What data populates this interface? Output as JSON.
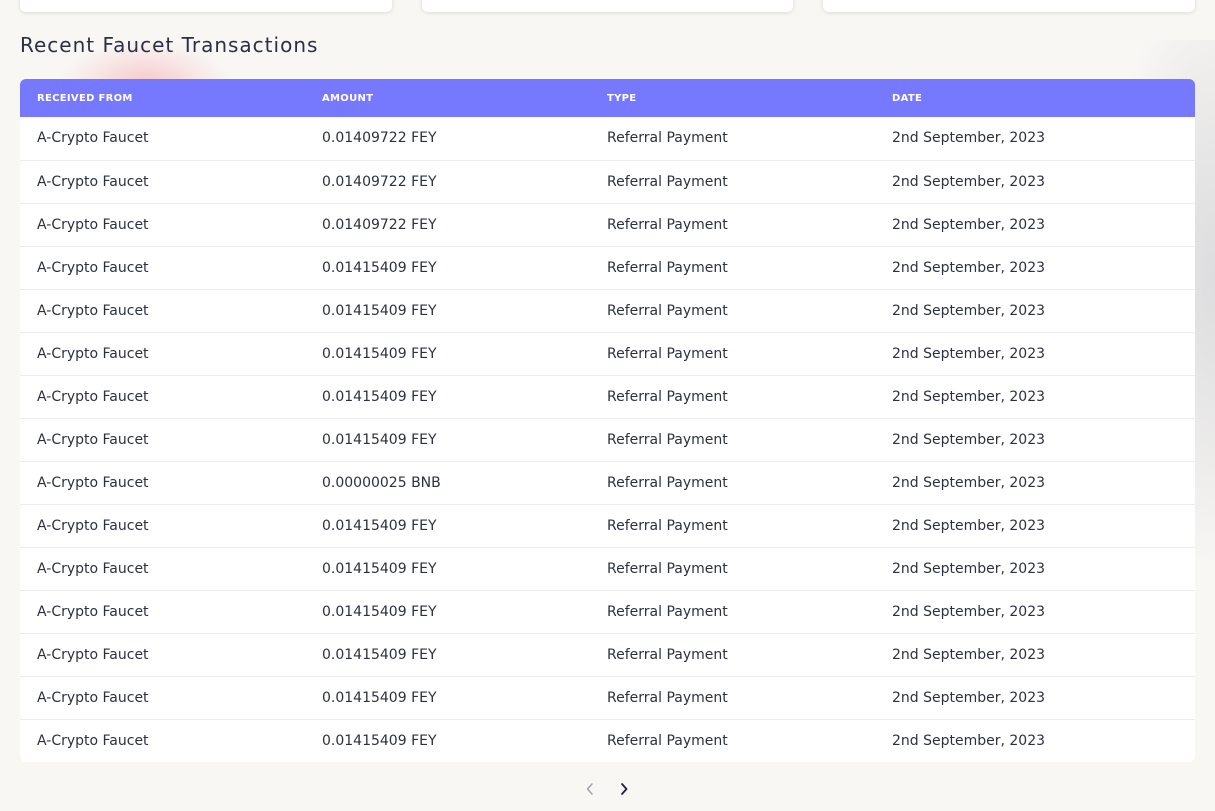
{
  "section": {
    "title": "Recent Faucet Transactions"
  },
  "table": {
    "headers": [
      "RECEIVED FROM",
      "AMOUNT",
      "TYPE",
      "DATE"
    ],
    "rows": [
      [
        "A-Crypto Faucet",
        "0.01409722 FEY",
        "Referral Payment",
        "2nd September, 2023"
      ],
      [
        "A-Crypto Faucet",
        "0.01409722 FEY",
        "Referral Payment",
        "2nd September, 2023"
      ],
      [
        "A-Crypto Faucet",
        "0.01409722 FEY",
        "Referral Payment",
        "2nd September, 2023"
      ],
      [
        "A-Crypto Faucet",
        "0.01415409 FEY",
        "Referral Payment",
        "2nd September, 2023"
      ],
      [
        "A-Crypto Faucet",
        "0.01415409 FEY",
        "Referral Payment",
        "2nd September, 2023"
      ],
      [
        "A-Crypto Faucet",
        "0.01415409 FEY",
        "Referral Payment",
        "2nd September, 2023"
      ],
      [
        "A-Crypto Faucet",
        "0.01415409 FEY",
        "Referral Payment",
        "2nd September, 2023"
      ],
      [
        "A-Crypto Faucet",
        "0.01415409 FEY",
        "Referral Payment",
        "2nd September, 2023"
      ],
      [
        "A-Crypto Faucet",
        "0.00000025 BNB",
        "Referral Payment",
        "2nd September, 2023"
      ],
      [
        "A-Crypto Faucet",
        "0.01415409 FEY",
        "Referral Payment",
        "2nd September, 2023"
      ],
      [
        "A-Crypto Faucet",
        "0.01415409 FEY",
        "Referral Payment",
        "2nd September, 2023"
      ],
      [
        "A-Crypto Faucet",
        "0.01415409 FEY",
        "Referral Payment",
        "2nd September, 2023"
      ],
      [
        "A-Crypto Faucet",
        "0.01415409 FEY",
        "Referral Payment",
        "2nd September, 2023"
      ],
      [
        "A-Crypto Faucet",
        "0.01415409 FEY",
        "Referral Payment",
        "2nd September, 2023"
      ],
      [
        "A-Crypto Faucet",
        "0.01415409 FEY",
        "Referral Payment",
        "2nd September, 2023"
      ]
    ]
  },
  "pagination": {
    "prev_icon": "chevron-left-icon",
    "next_icon": "chevron-right-icon"
  },
  "colors": {
    "header_bg": "#7678fd",
    "page_bg": "#f8f7f4"
  }
}
